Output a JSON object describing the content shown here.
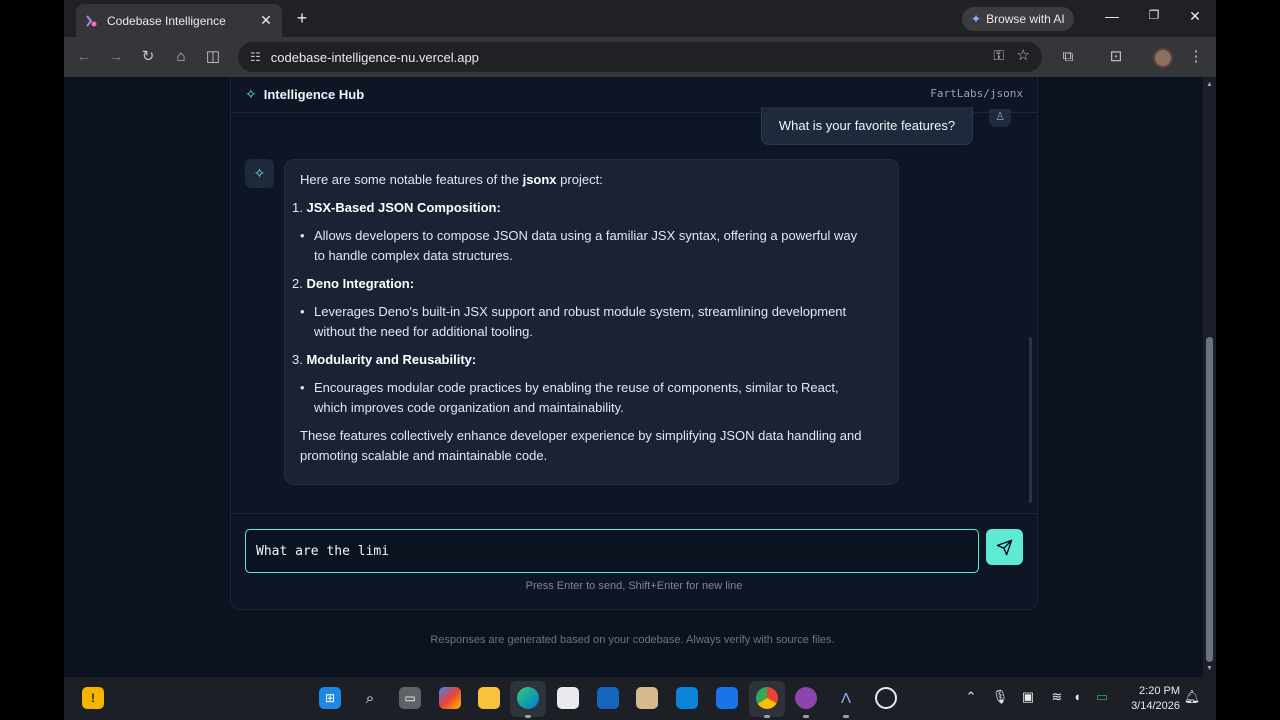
{
  "browser": {
    "tab_title": "Codebase Intelligence",
    "tab_close": "✕",
    "new_tab": "+",
    "ai_button": "Browse with AI",
    "url": "codebase-intelligence-nu.vercel.app",
    "window_controls": [
      "minimize",
      "restore",
      "close"
    ]
  },
  "header": {
    "title": "Intelligence Hub",
    "repo": "FartLabs/jsonx"
  },
  "chat": {
    "user_message": "What is your favorite features?",
    "assistant": {
      "intro_pre": "Here are some notable features of the ",
      "intro_bold": "jsonx",
      "intro_post": " project:",
      "items": [
        {
          "num": "1.",
          "title": "JSX-Based JSON Composition:",
          "bullet_lines": [
            "Allows developers to compose JSON data using a familiar JSX syntax, offering a powerful way",
            "to handle complex data structures."
          ]
        },
        {
          "num": "2.",
          "title": "Deno Integration:",
          "bullet_lines": [
            "Leverages Deno's built-in JSX support and robust module system, streamlining development",
            "without the need for additional tooling."
          ]
        },
        {
          "num": "3.",
          "title": "Modularity and Reusability:",
          "bullet_lines": [
            "Encourages modular code practices by enabling the reuse of components, similar to React,",
            "which improves code organization and maintainability."
          ]
        }
      ],
      "conclusion_lines": [
        "These features collectively enhance developer experience by simplifying JSON data handling and",
        "promoting scalable and maintainable code."
      ]
    }
  },
  "composer": {
    "value": "What are the limi",
    "hint": "Press Enter to send, Shift+Enter for new line"
  },
  "footer_note": "Responses are generated based on your codebase. Always verify with source files.",
  "taskbar": {
    "warning_badge": "!",
    "time": "2:20 PM",
    "date": "3/14/2026"
  },
  "colors": {
    "accent": "#5eead4",
    "page_bg": "#0b1220",
    "bubble_bg": "#1a2233"
  }
}
